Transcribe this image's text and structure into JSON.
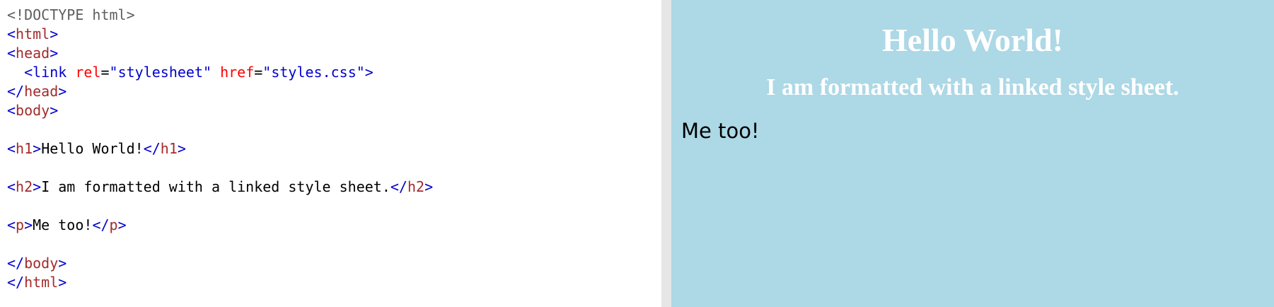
{
  "code_editor": {
    "lines": [
      [
        {
          "t": "<!DOCTYPE html>",
          "c": "doctype"
        }
      ],
      [
        {
          "t": "<",
          "c": "bracket"
        },
        {
          "t": "html",
          "c": "tag"
        },
        {
          "t": ">",
          "c": "bracket"
        }
      ],
      [
        {
          "t": "<",
          "c": "bracket"
        },
        {
          "t": "head",
          "c": "tag"
        },
        {
          "t": ">",
          "c": "bracket"
        }
      ],
      [
        {
          "t": "  ",
          "c": "text"
        },
        {
          "t": "<",
          "c": "bracket"
        },
        {
          "t": "link",
          "c": "bracket"
        },
        {
          "t": " ",
          "c": "text"
        },
        {
          "t": "rel",
          "c": "attr"
        },
        {
          "t": "=",
          "c": "text"
        },
        {
          "t": "\"stylesheet\"",
          "c": "val"
        },
        {
          "t": " ",
          "c": "text"
        },
        {
          "t": "href",
          "c": "attr"
        },
        {
          "t": "=",
          "c": "text"
        },
        {
          "t": "\"styles.css\"",
          "c": "val"
        },
        {
          "t": ">",
          "c": "bracket"
        }
      ],
      [
        {
          "t": "</",
          "c": "bracket"
        },
        {
          "t": "head",
          "c": "tag"
        },
        {
          "t": ">",
          "c": "bracket"
        }
      ],
      [
        {
          "t": "<",
          "c": "bracket"
        },
        {
          "t": "body",
          "c": "tag"
        },
        {
          "t": ">",
          "c": "bracket"
        }
      ],
      [],
      [
        {
          "t": "<",
          "c": "bracket"
        },
        {
          "t": "h1",
          "c": "tag"
        },
        {
          "t": ">",
          "c": "bracket"
        },
        {
          "t": "Hello World!",
          "c": "text"
        },
        {
          "t": "</",
          "c": "bracket"
        },
        {
          "t": "h1",
          "c": "tag"
        },
        {
          "t": ">",
          "c": "bracket"
        }
      ],
      [],
      [
        {
          "t": "<",
          "c": "bracket"
        },
        {
          "t": "h2",
          "c": "tag"
        },
        {
          "t": ">",
          "c": "bracket"
        },
        {
          "t": "I am formatted with a linked style sheet.",
          "c": "text"
        },
        {
          "t": "</",
          "c": "bracket"
        },
        {
          "t": "h2",
          "c": "tag"
        },
        {
          "t": ">",
          "c": "bracket"
        }
      ],
      [],
      [
        {
          "t": "<",
          "c": "bracket"
        },
        {
          "t": "p",
          "c": "tag"
        },
        {
          "t": ">",
          "c": "bracket"
        },
        {
          "t": "Me too!",
          "c": "text"
        },
        {
          "t": "</",
          "c": "bracket"
        },
        {
          "t": "p",
          "c": "tag"
        },
        {
          "t": ">",
          "c": "bracket"
        }
      ],
      [],
      [
        {
          "t": "</",
          "c": "bracket"
        },
        {
          "t": "body",
          "c": "tag"
        },
        {
          "t": ">",
          "c": "bracket"
        }
      ],
      [
        {
          "t": "</",
          "c": "bracket"
        },
        {
          "t": "html",
          "c": "tag"
        },
        {
          "t": ">",
          "c": "bracket"
        }
      ]
    ]
  },
  "result": {
    "h1": "Hello World!",
    "h2": "I am formatted with a linked style sheet.",
    "p": "Me too!",
    "background": "#add8e6",
    "heading_color": "#ffffff"
  },
  "colors": {
    "bracket": "#0000cd",
    "tag": "#a52a2a",
    "attr": "#ff0000",
    "val": "#0000cd",
    "doctype": "#5e5e5e",
    "divider": "#e6e6e6"
  }
}
